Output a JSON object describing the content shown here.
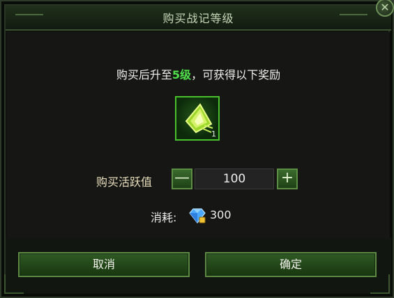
{
  "dialog": {
    "title": "购买战记等级",
    "close_icon": "close-icon"
  },
  "reward": {
    "prefix": "购买后升至",
    "level": "5级",
    "suffix": "，可获得以下奖励",
    "item_icon": "green-crystal-icon",
    "item_count": "1"
  },
  "purchase": {
    "label": "购买活跃值",
    "minus": "—",
    "plus": "+",
    "quantity": "100"
  },
  "cost": {
    "label": "消耗:",
    "currency_icon": "diamond-icon",
    "value": "300"
  },
  "buttons": {
    "cancel": "取消",
    "confirm": "确定"
  },
  "colors": {
    "highlight": "#4fe04a",
    "button_green": "#2f5a24",
    "border_green": "#5c8a43"
  }
}
